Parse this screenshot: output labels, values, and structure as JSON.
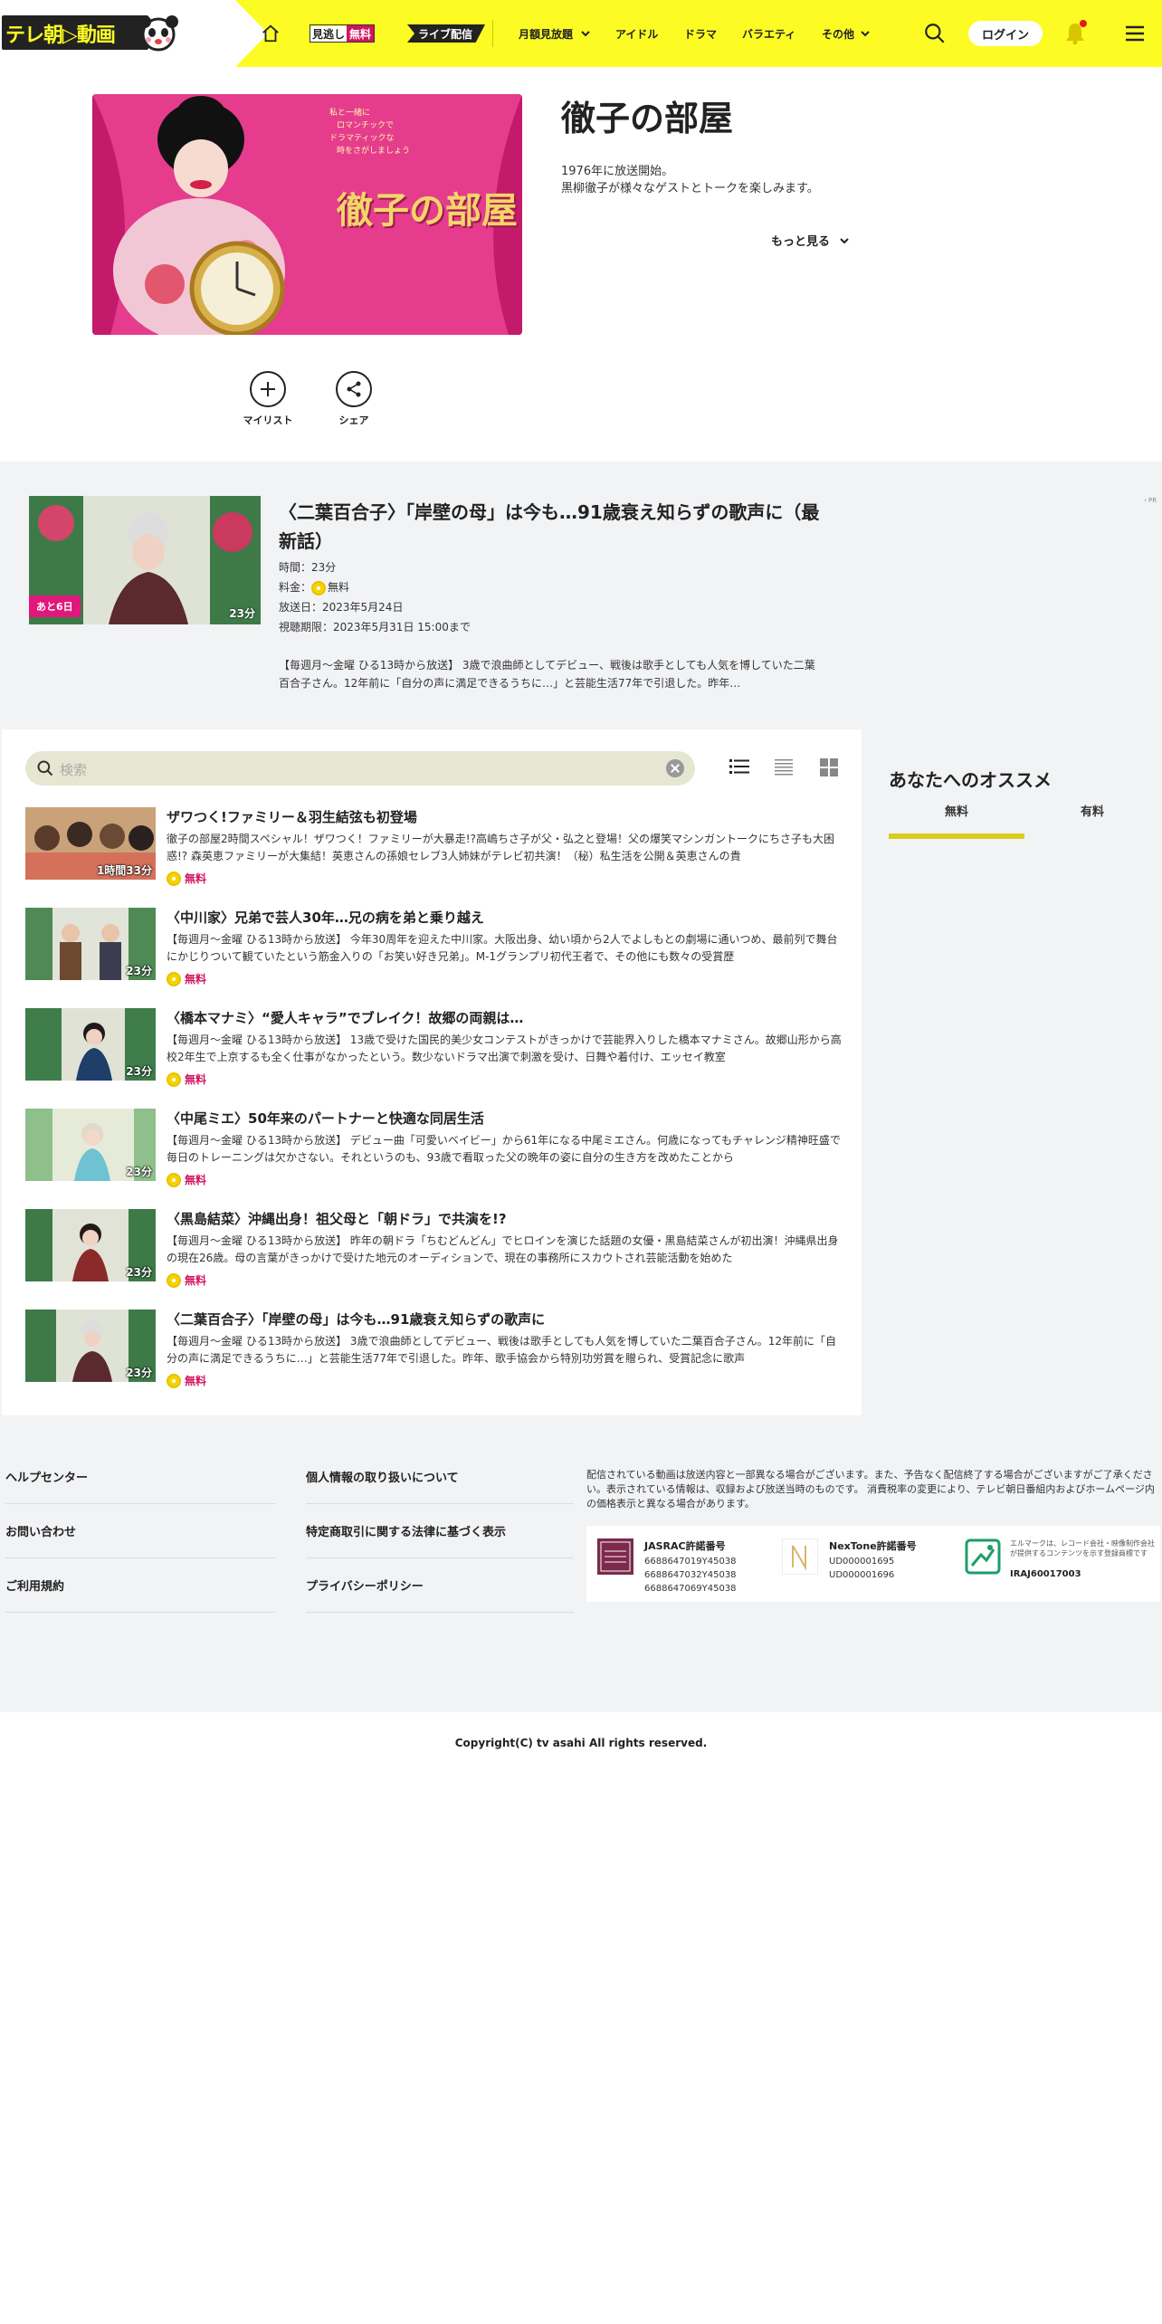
{
  "header": {
    "logo_text": "テレ朝▷動画",
    "nav": {
      "mino_left": "見逃し",
      "mino_right": "無料",
      "live": "ライブ配信",
      "monthly": "月額見放題",
      "idol": "アイドル",
      "drama": "ドラマ",
      "variety": "バラエティ",
      "other": "その他"
    },
    "login_label": "ログイン"
  },
  "program": {
    "title": "徹子の部屋",
    "image_title": "徹子の部屋",
    "image_caption": [
      "私と一緒に",
      "ロマンチックで",
      "ドラマティックな",
      "時をさがしましょう"
    ],
    "description_lines": [
      "1976年に放送開始。",
      "黒柳徹子が様々なゲストとトークを楽しみます。"
    ],
    "more_label": "もっと見る",
    "mylist_label": "マイリスト",
    "share_label": "シェア"
  },
  "latest": {
    "badge": "あと6日",
    "duration": "23分",
    "title": "〈二葉百合子〉「岸壁の母」は今も…91歳衰え知らずの歌声に（最新話）",
    "time": "時間：23分",
    "price_label": "料金：",
    "price_value": "無料",
    "air_date": "放送日：2023年5月24日",
    "deadline": "視聴期限：2023年5月31日 15:00まで",
    "description": "【毎週月～金曜 ひる13時から放送】 3歳で浪曲師としてデビュー、戦後は歌手としても人気を博していた二葉百合子さん。12年前に「自分の声に満足できるうちに…」と芸能生活77年で引退した。昨年…",
    "ad_tag": "・PR"
  },
  "search": {
    "placeholder": "検索"
  },
  "episodes": [
    {
      "title": "ザワつく!ファミリー＆羽生結弦も初登場",
      "duration": "1時間33分",
      "description": "徹子の部屋2時間スペシャル！ザワつく！ファミリーが大暴走!?高嶋ちさ子が父・弘之と登場！父の爆笑マシンガントークにちさ子も大困惑!? 森英恵ファミリーが大集結！英恵さんの孫娘セレブ3人姉妹がテレビ初共演！（秘）私生活を公開＆英恵さんの貴",
      "free": "無料"
    },
    {
      "title": "〈中川家〉兄弟で芸人30年…兄の病を弟と乗り越え",
      "duration": "23分",
      "description": "【毎週月～金曜 ひる13時から放送】 今年30周年を迎えた中川家。大阪出身、幼い頃から2人でよしもとの劇場に通いつめ、最前列で舞台にかじりついて観ていたという筋金入りの「お笑い好き兄弟」。M-1グランプリ初代王者で、その他にも数々の受賞歴",
      "free": "無料"
    },
    {
      "title": "〈橋本マナミ〉“愛人キャラ”でブレイク！故郷の両親は…",
      "duration": "23分",
      "description": "【毎週月～金曜 ひる13時から放送】 13歳で受けた国民的美少女コンテストがきっかけで芸能界入りした橋本マナミさん。故郷山形から高校2年生で上京するも全く仕事がなかったという。数少ないドラマ出演で刺激を受け、日舞や着付け、エッセイ教室",
      "free": "無料"
    },
    {
      "title": "〈中尾ミエ〉50年来のパートナーと快適な同居生活",
      "duration": "23分",
      "description": "【毎週月～金曜 ひる13時から放送】 デビュー曲「可愛いベイビー」から61年になる中尾ミエさん。何歳になってもチャレンジ精神旺盛で毎日のトレーニングは欠かさない。それというのも、93歳で看取った父の晩年の姿に自分の生き方を改めたことから",
      "free": "無料"
    },
    {
      "title": "〈黒島結菜〉沖縄出身！祖父母と「朝ドラ」で共演を!?",
      "duration": "23分",
      "description": "【毎週月～金曜 ひる13時から放送】 昨年の朝ドラ「ちむどんどん」でヒロインを演じた話題の女優・黒島結菜さんが初出演！沖縄県出身の現在26歳。母の言葉がきっかけで受けた地元のオーディションで、現在の事務所にスカウトされ芸能活動を始めた",
      "free": "無料"
    },
    {
      "title": "〈二葉百合子〉「岸壁の母」は今も…91歳衰え知らずの歌声に",
      "duration": "23分",
      "description": "【毎週月～金曜 ひる13時から放送】 3歳で浪曲師としてデビュー、戦後は歌手としても人気を博していた二葉百合子さん。12年前に「自分の声に満足できるうちに…」と芸能生活77年で引退した。昨年、歌手協会から特別功労賞を贈られ、受賞記念に歌声",
      "free": "無料"
    }
  ],
  "recommend": {
    "title": "あなたへのオススメ",
    "tab_free": "無料",
    "tab_paid": "有料"
  },
  "footer": {
    "links_left": [
      "ヘルプセンター",
      "お問い合わせ",
      "ご利用規約"
    ],
    "links_right": [
      "個人情報の取り扱いについて",
      "特定商取引に関する法律に基づく表示",
      "プライバシーポリシー"
    ],
    "notice": "配信されている動画は放送内容と一部異なる場合がございます。また、予告なく配信終了する場合がございますがご了承ください。表示されている情報は、収録および放送当時のものです。 消費税率の変更により、テレビ朝日番組内およびホームページ内の価格表示と異なる場合があります。",
    "jasrac": {
      "title": "JASRAC許諾番号",
      "numbers": [
        "6688647019Y45038",
        "6688647032Y45038",
        "6688647069Y45038"
      ]
    },
    "nextone": {
      "title": "NexTone許諾番号",
      "numbers": [
        "UD000001695",
        "UD000001696"
      ]
    },
    "elmark": {
      "note": "エルマークは、レコード会社・映像制作会社が提供するコンテンツを示す登録商標です",
      "number": "IRAJ60017003"
    },
    "copyright": "Copyright(C) tv asahi All rights reserved."
  },
  "colors": {
    "brand_yellow": "#fcfc24",
    "accent_pink": "#d0155f",
    "tab_underline": "#d8ce1e"
  }
}
